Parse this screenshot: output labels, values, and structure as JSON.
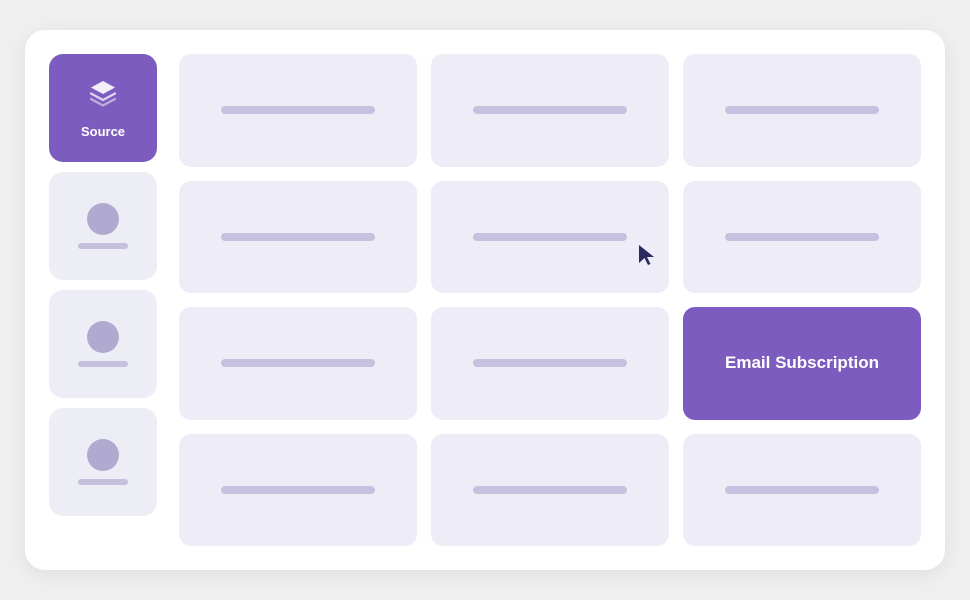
{
  "sidebar": {
    "items": [
      {
        "id": "source",
        "label": "Source",
        "active": true
      },
      {
        "id": "user1",
        "label": "",
        "active": false
      },
      {
        "id": "user2",
        "label": "",
        "active": false
      },
      {
        "id": "user3",
        "label": "",
        "active": false
      }
    ]
  },
  "grid": {
    "rows": 4,
    "cols": 3,
    "highlight_cell": {
      "row": 2,
      "col": 2
    },
    "highlight_label": "Email Subscription"
  },
  "colors": {
    "active_bg": "#7c5cbf",
    "card_bg": "#eeedf7",
    "card_bar": "#c5c2e0",
    "sidebar_inactive_bg": "#ededf5"
  }
}
